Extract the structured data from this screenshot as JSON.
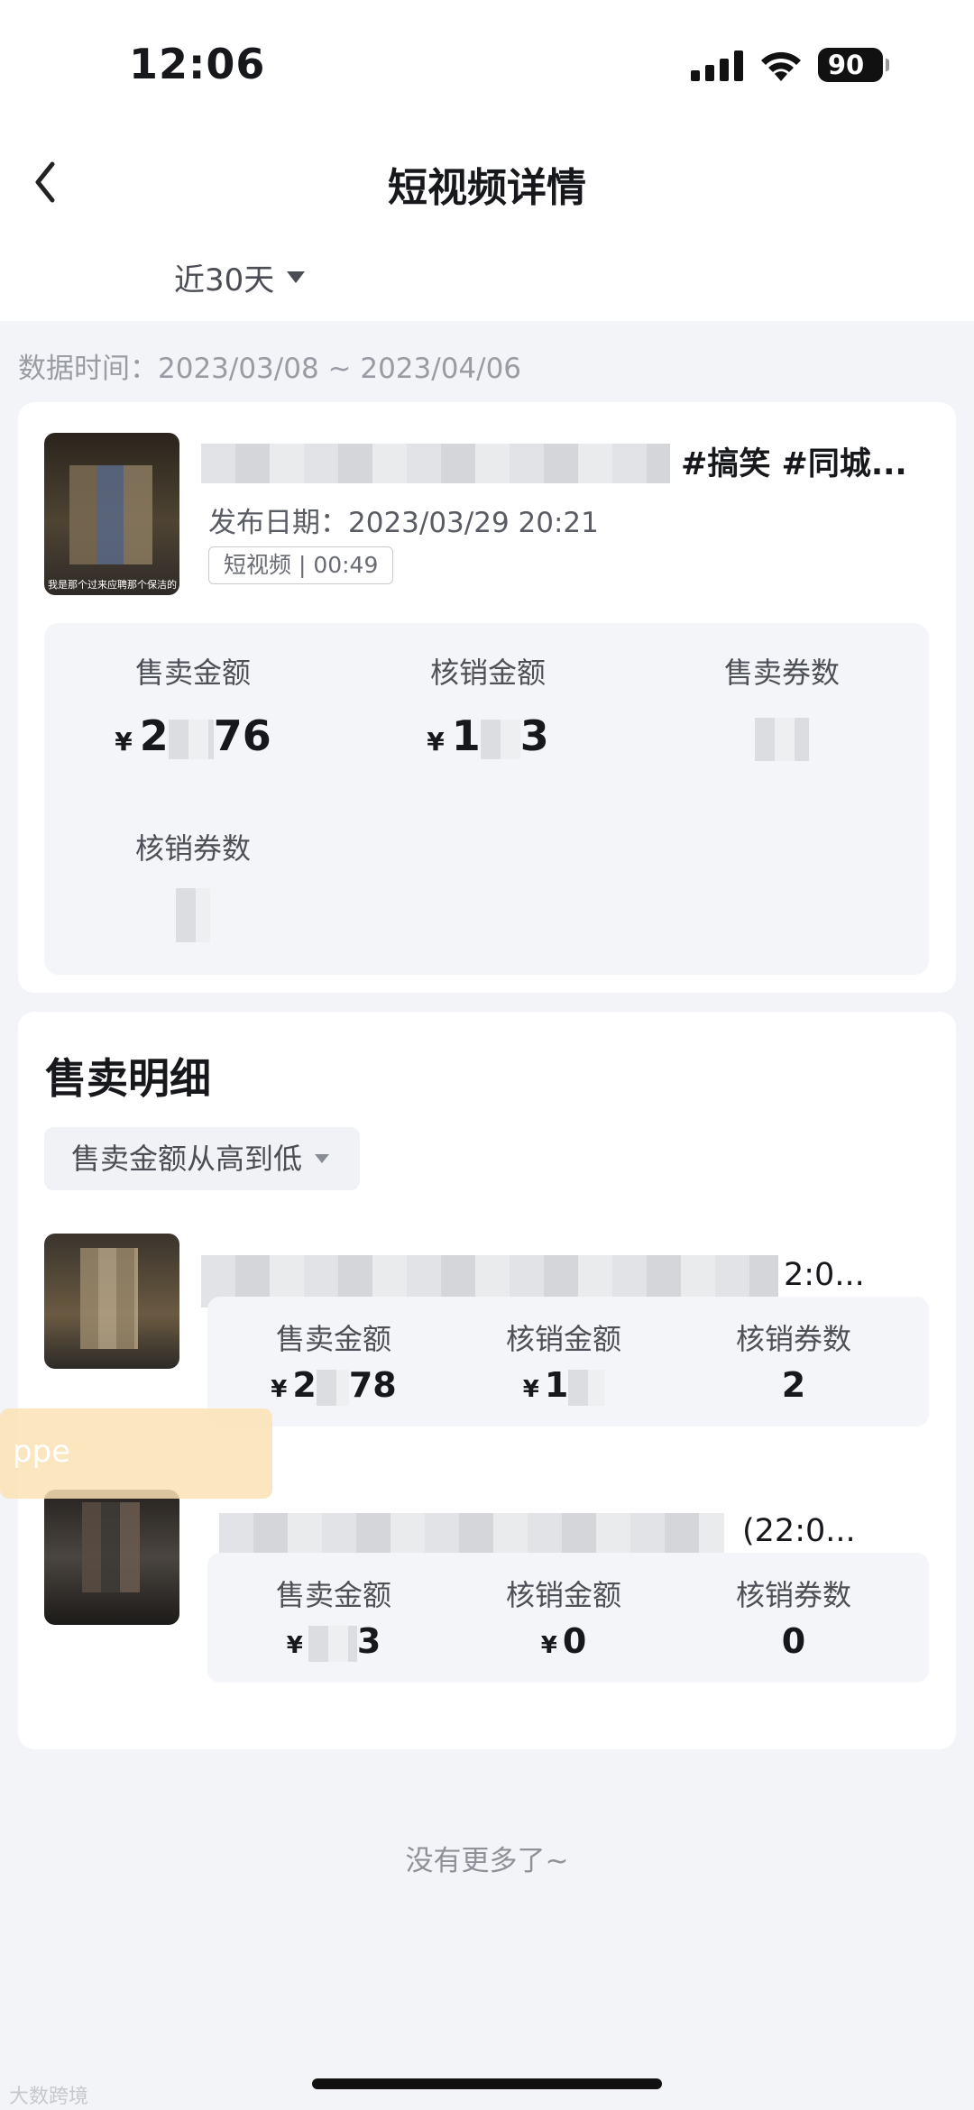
{
  "status_bar": {
    "time": "12:06",
    "battery": "90"
  },
  "header": {
    "title": "短视频详情",
    "back_icon": "chevron-left-icon"
  },
  "filter": {
    "range": "近30天"
  },
  "data_time": "数据时间：2023/03/08 ~ 2023/04/06",
  "video": {
    "title_visible": "#搞笑 #同城...",
    "publish_date": "发布日期：2023/03/29 20:21",
    "badge": "短视频 | 00:49",
    "thumb_caption": "我是那个过来应聘那个保洁的",
    "stats": [
      {
        "label": "售卖金额",
        "currency": "¥",
        "value_prefix": "2",
        "value_suffix": "76"
      },
      {
        "label": "核销金额",
        "currency": "¥",
        "value_prefix": "1",
        "value_suffix": "3"
      },
      {
        "label": "售卖券数",
        "currency": "",
        "value_prefix": "",
        "value_suffix": ""
      },
      {
        "label": "核销券数",
        "currency": "",
        "value_prefix": "",
        "value_suffix": ""
      }
    ]
  },
  "sales_detail": {
    "title": "售卖明细",
    "sort_label": "售卖金额从高到低",
    "items": [
      {
        "title_tail": "2:0...",
        "stats": [
          {
            "label": "售卖金额",
            "currency": "¥",
            "value_prefix": "2",
            "value_suffix": "78"
          },
          {
            "label": "核销金额",
            "currency": "¥",
            "value_prefix": "1",
            "value_suffix": ""
          },
          {
            "label": "核销券数",
            "currency": "",
            "value_prefix": "2",
            "value_suffix": ""
          }
        ]
      },
      {
        "title_tail": "(22:0...",
        "stats": [
          {
            "label": "售卖金额",
            "currency": "¥",
            "value_prefix": "",
            "value_suffix": "3"
          },
          {
            "label": "核销金额",
            "currency": "¥",
            "value_prefix": "0",
            "value_suffix": ""
          },
          {
            "label": "核销券数",
            "currency": "",
            "value_prefix": "0",
            "value_suffix": ""
          }
        ]
      }
    ]
  },
  "toast": "ppe",
  "footer": {
    "no_more": "没有更多了~"
  },
  "watermark": "大数跨境"
}
